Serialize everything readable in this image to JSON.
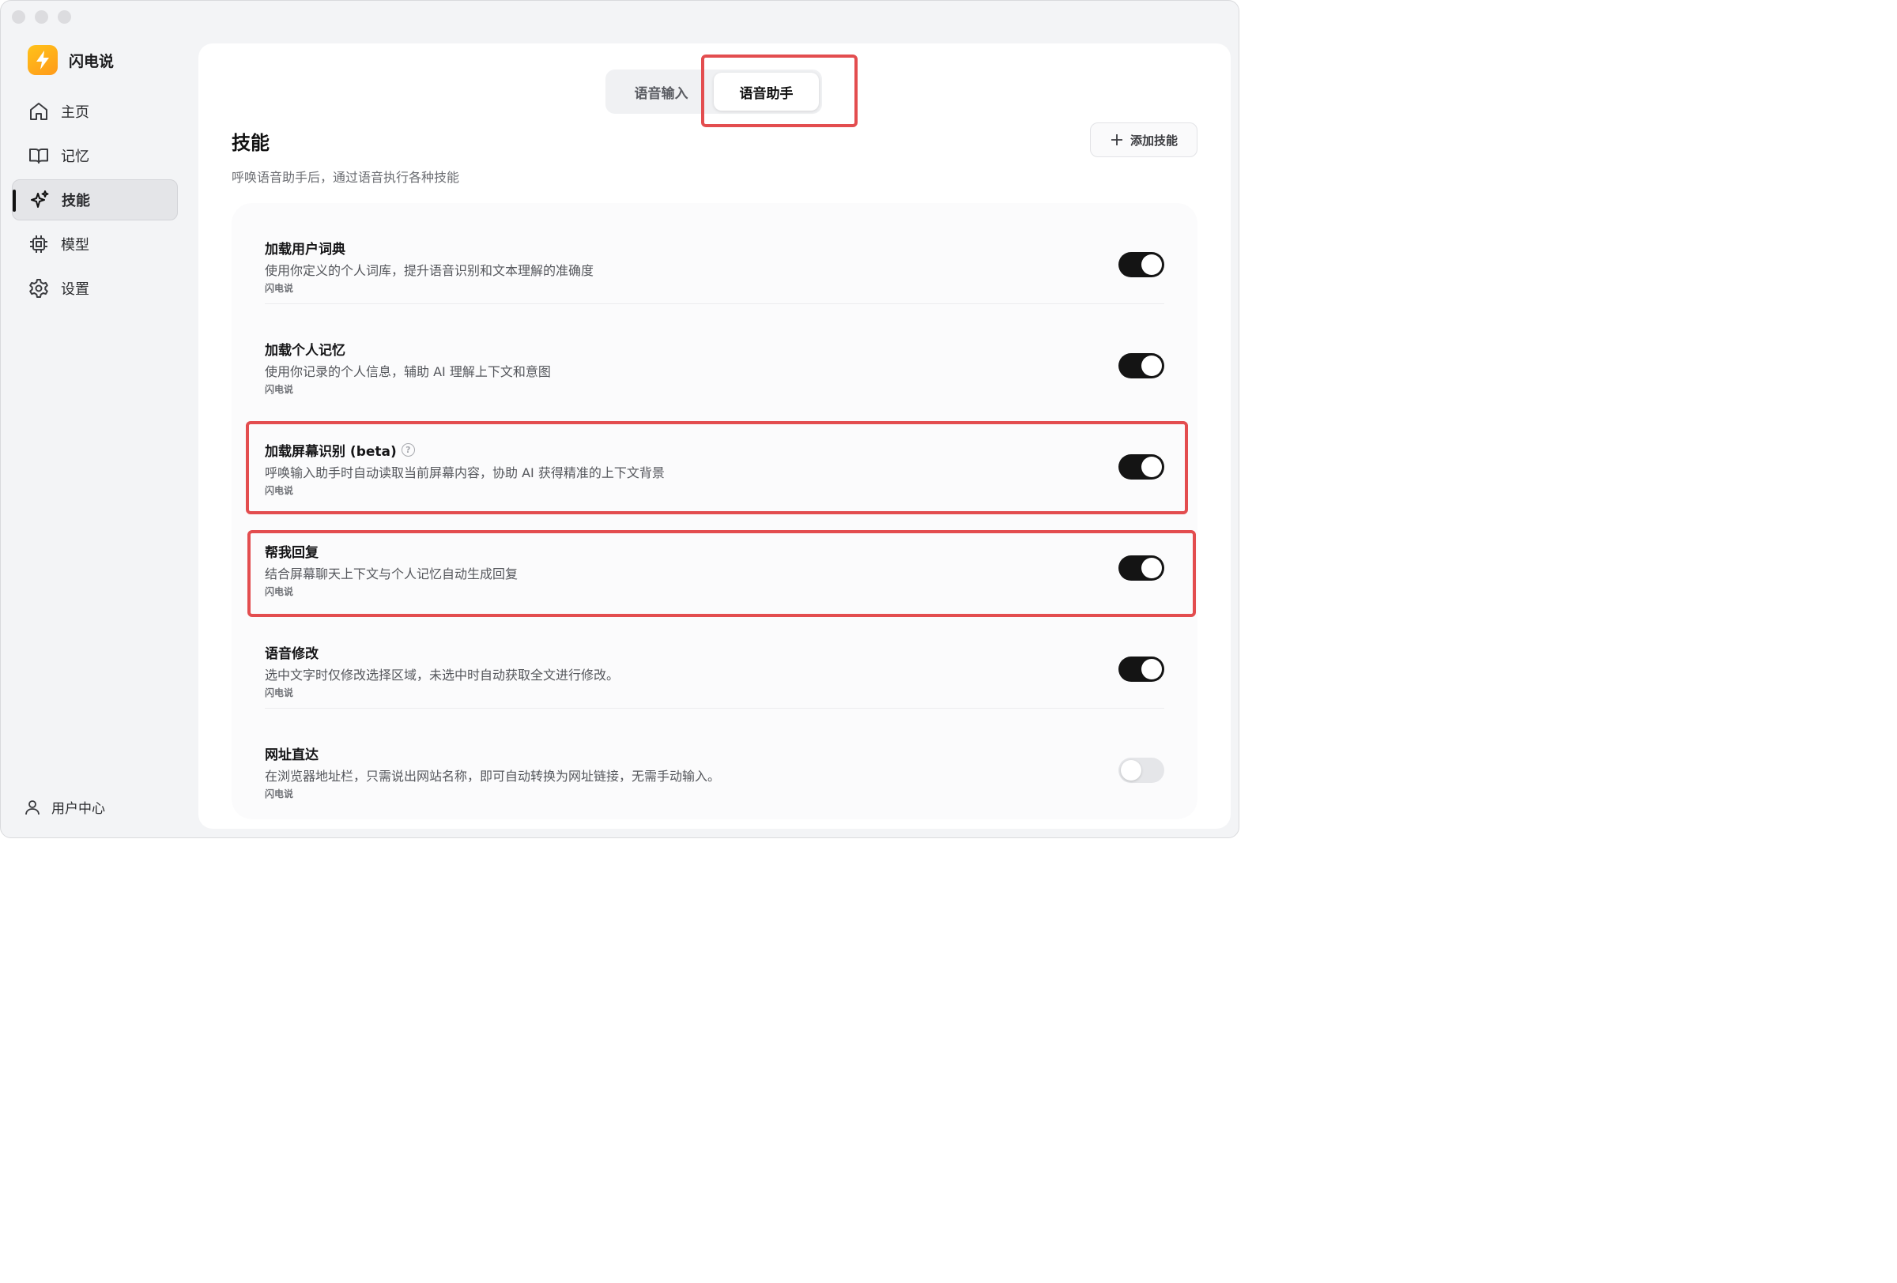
{
  "app": {
    "name": "闪电说"
  },
  "sidebar": {
    "items": [
      {
        "label": "主页",
        "icon": "home-icon"
      },
      {
        "label": "记忆",
        "icon": "book-icon"
      },
      {
        "label": "技能",
        "icon": "sparkle-icon",
        "active": true
      },
      {
        "label": "模型",
        "icon": "chip-icon"
      },
      {
        "label": "设置",
        "icon": "gear-icon"
      }
    ],
    "user_center": "用户中心"
  },
  "tabs": [
    {
      "label": "语音输入",
      "active": false
    },
    {
      "label": "语音助手",
      "active": true
    }
  ],
  "page": {
    "title": "技能",
    "subtitle": "呼唤语音助手后，通过语音执行各种技能",
    "add_button": "添加技能"
  },
  "skills": [
    {
      "title": "加载用户词典",
      "desc": "使用你定义的个人词库，提升语音识别和文本理解的准确度",
      "source": "闪电说",
      "enabled": true
    },
    {
      "title": "加载个人记忆",
      "desc": "使用你记录的个人信息，辅助 AI 理解上下文和意图",
      "source": "闪电说",
      "enabled": true
    },
    {
      "title": "加载屏幕识别 (beta)",
      "desc": "呼唤输入助手时自动读取当前屏幕内容，协助 AI 获得精准的上下文背景",
      "source": "闪电说",
      "enabled": true,
      "help": true
    },
    {
      "title": "帮我回复",
      "desc": "结合屏幕聊天上下文与个人记忆自动生成回复",
      "source": "闪电说",
      "enabled": true
    },
    {
      "title": "语音修改",
      "desc": "选中文字时仅修改选择区域，未选中时自动获取全文进行修改。",
      "source": "闪电说",
      "enabled": true
    },
    {
      "title": "网址直达",
      "desc": "在浏览器地址栏，只需说出网站名称，即可自动转换为网址链接，无需手动输入。",
      "source": "闪电说",
      "enabled": false
    }
  ],
  "colors": {
    "highlight": "#e34d4f",
    "brand": "#ffb01a",
    "toggle_on": "#141414"
  }
}
